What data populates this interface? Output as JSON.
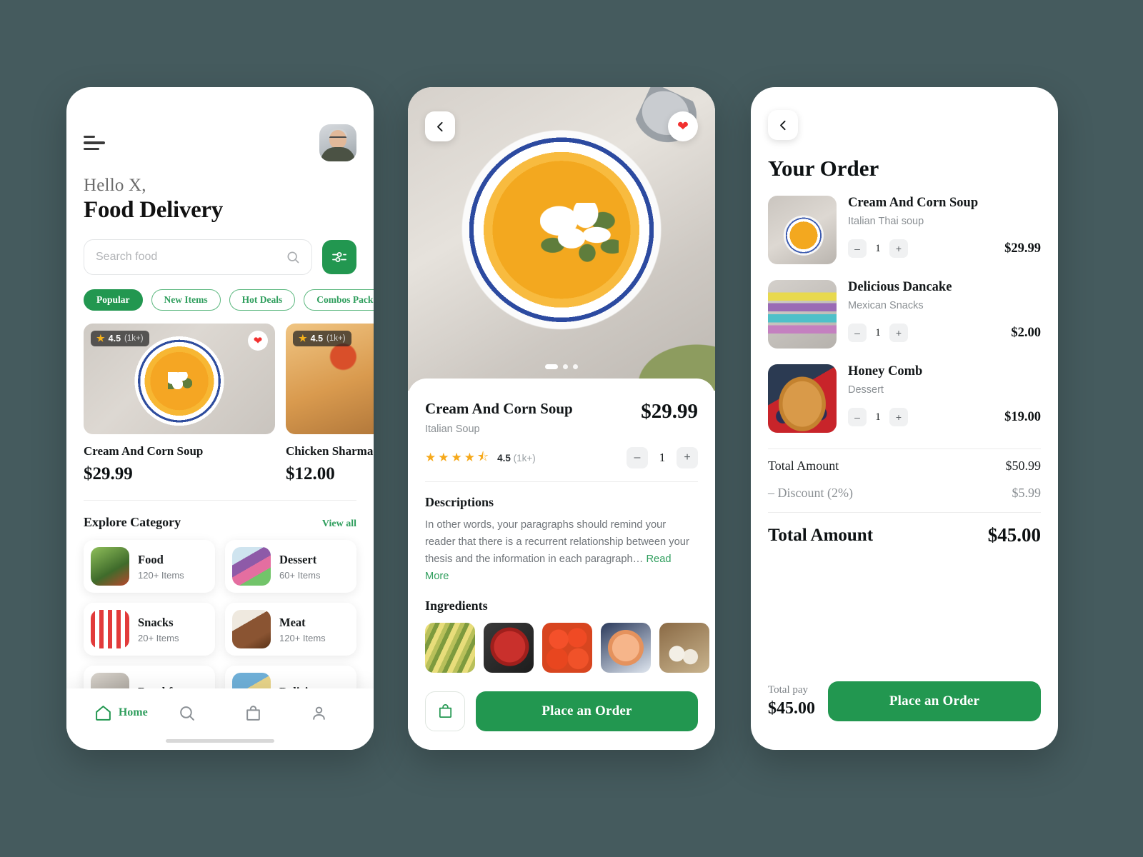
{
  "theme": {
    "accent": "#229750",
    "accent_light": "#2f9e5d",
    "background": "#455b5e",
    "heart": "#f2302f",
    "star": "#f6a91b"
  },
  "home": {
    "menu_icon": "hamburger-icon",
    "avatar": "user-avatar",
    "greeting": "Hello X,",
    "title": "Food Delivery",
    "search": {
      "placeholder": "Search food",
      "value": "",
      "icon": "search-icon"
    },
    "filter_icon": "sliders-filter-icon",
    "chips": [
      {
        "label": "Popular",
        "active": true
      },
      {
        "label": "New Items",
        "active": false
      },
      {
        "label": "Hot Deals",
        "active": false
      },
      {
        "label": "Combos Pack",
        "active": false
      }
    ],
    "foods": [
      {
        "name": "Cream And Corn Soup",
        "price": "$29.99",
        "rating": "4.5",
        "reviews": "(1k+)",
        "favorite": true
      },
      {
        "name": "Chicken Sharma",
        "price": "$12.00",
        "rating": "4.5",
        "reviews": "(1k+)",
        "favorite": false
      }
    ],
    "category_section": {
      "title": "Explore Category",
      "view_all": "View all"
    },
    "categories": [
      {
        "name": "Food",
        "count": "120+ Items"
      },
      {
        "name": "Dessert",
        "count": "60+ Items"
      },
      {
        "name": "Snacks",
        "count": "20+ Items"
      },
      {
        "name": "Meat",
        "count": "120+ Items"
      },
      {
        "name": "Breakfast",
        "count": ""
      },
      {
        "name": "Delicious",
        "count": ""
      }
    ],
    "tabs": [
      {
        "label": "Home",
        "icon": "home-icon",
        "active": true
      },
      {
        "label": "",
        "icon": "search-icon",
        "active": false
      },
      {
        "label": "",
        "icon": "bag-icon",
        "active": false
      },
      {
        "label": "",
        "icon": "person-icon",
        "active": false
      }
    ]
  },
  "detail": {
    "back_icon": "chevron-left-icon",
    "favorite_icon": "heart-icon",
    "carousel": {
      "total": 3,
      "active": 1
    },
    "name": "Cream And Corn Soup",
    "subtitle": "Italian Soup",
    "price": "$29.99",
    "rating_value": "4.5",
    "rating_count": "(1k+)",
    "rating_stars": 4.5,
    "quantity": "1",
    "minus_label": "–",
    "plus_label": "+",
    "descriptions_title": "Descriptions",
    "description_text": " In other words, your paragraphs should remind your reader that there is a recurrent relationship between your thesis and the information in each paragraph… ",
    "read_label": "Read",
    "more_label": "More",
    "ingredients_title": "Ingredients",
    "ingredients": [
      "corn",
      "beef",
      "tomato",
      "shrimp",
      "mushroom"
    ],
    "bag_icon": "bag-icon",
    "order_button": "Place an Order"
  },
  "order": {
    "back_icon": "chevron-left-icon",
    "title": "Your Order",
    "items": [
      {
        "name": "Cream And Corn Soup",
        "sub": "Italian Thai soup",
        "qty": "1",
        "price": "$29.99"
      },
      {
        "name": "Delicious Dancake",
        "sub": "Mexican Snacks",
        "qty": "1",
        "price": "$2.00"
      },
      {
        "name": "Honey Comb",
        "sub": "Dessert",
        "qty": "1",
        "price": "$19.00"
      }
    ],
    "minus_label": "–",
    "plus_label": "+",
    "summary": [
      {
        "label": "Total Amount",
        "value": "$50.99",
        "muted": false
      },
      {
        "label": "– Discount (2%)",
        "value": "$5.99",
        "muted": true
      }
    ],
    "grand_label": "Total Amount",
    "grand_value": "$45.00",
    "pay_label": "Total pay",
    "pay_value": "$45.00",
    "order_button": "Place an Order"
  }
}
